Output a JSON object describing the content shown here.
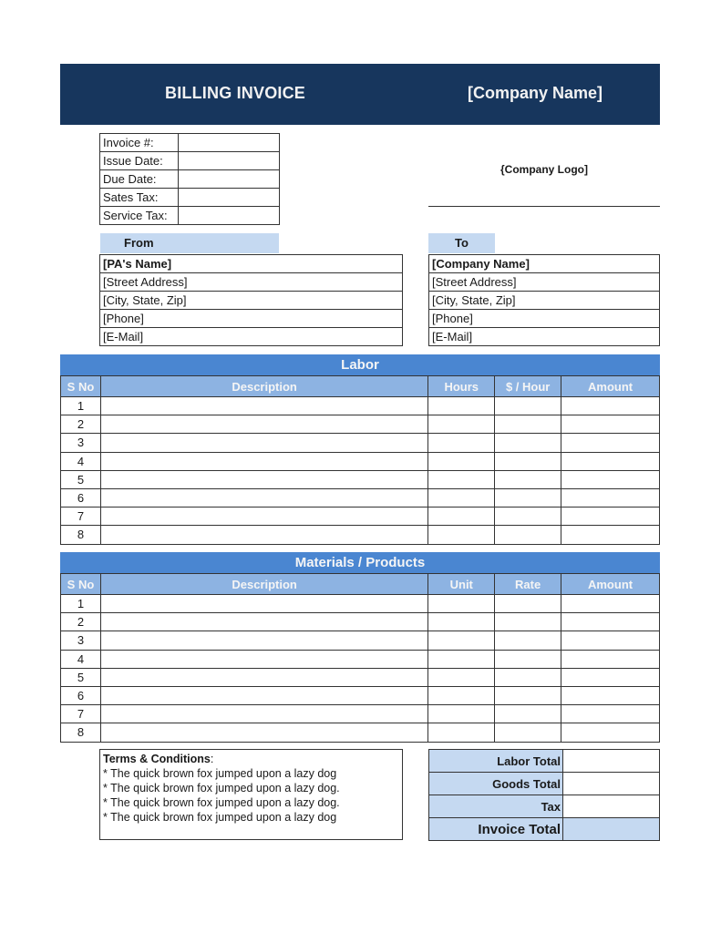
{
  "header": {
    "title": "BILLING INVOICE",
    "company_name": "[Company Name]"
  },
  "meta_fields": [
    {
      "label": "Invoice #:",
      "value": ""
    },
    {
      "label": "Issue Date:",
      "value": ""
    },
    {
      "label": "Due Date:",
      "value": ""
    },
    {
      "label": "Sates Tax:",
      "value": ""
    },
    {
      "label": "Service Tax:",
      "value": ""
    }
  ],
  "logo_placeholder": "{Company Logo]",
  "from": {
    "heading": "From",
    "lines": [
      "[PA's Name]",
      "[Street Address]",
      "[City, State, Zip]",
      "[Phone]",
      "[E-Mail]"
    ]
  },
  "to": {
    "heading": "To",
    "lines": [
      "[Company Name]",
      "[Street Address]",
      "[City, State, Zip]",
      "[Phone]",
      "[E-Mail]"
    ]
  },
  "labor": {
    "title": "Labor",
    "columns": [
      "S No",
      "Description",
      "Hours",
      "$ / Hour",
      "Amount"
    ],
    "rows": [
      [
        "1",
        "",
        "",
        "",
        ""
      ],
      [
        "2",
        "",
        "",
        "",
        ""
      ],
      [
        "3",
        "",
        "",
        "",
        ""
      ],
      [
        "4",
        "",
        "",
        "",
        ""
      ],
      [
        "5",
        "",
        "",
        "",
        ""
      ],
      [
        "6",
        "",
        "",
        "",
        ""
      ],
      [
        "7",
        "",
        "",
        "",
        ""
      ],
      [
        "8",
        "",
        "",
        "",
        ""
      ]
    ]
  },
  "materials": {
    "title": "Materials / Products",
    "columns": [
      "S No",
      "Description",
      "Unit",
      "Rate",
      "Amount"
    ],
    "rows": [
      [
        "1",
        "",
        "",
        "",
        ""
      ],
      [
        "2",
        "",
        "",
        "",
        ""
      ],
      [
        "3",
        "",
        "",
        "",
        ""
      ],
      [
        "4",
        "",
        "",
        "",
        ""
      ],
      [
        "5",
        "",
        "",
        "",
        ""
      ],
      [
        "6",
        "",
        "",
        "",
        ""
      ],
      [
        "7",
        "",
        "",
        "",
        ""
      ],
      [
        "8",
        "",
        "",
        "",
        ""
      ]
    ]
  },
  "terms": {
    "title": "Terms & Conditions",
    "colon": ":",
    "lines": [
      "* The quick brown fox jumped upon a lazy dog",
      "* The quick brown fox jumped upon a lazy dog.",
      "* The quick brown fox jumped upon a lazy dog.",
      "* The quick brown fox jumped upon a lazy dog"
    ]
  },
  "totals": [
    {
      "label": "Labor Total",
      "value": ""
    },
    {
      "label": "Goods Total",
      "value": ""
    },
    {
      "label": "Tax",
      "value": ""
    },
    {
      "label": "Invoice Total",
      "value": ""
    }
  ],
  "colors": {
    "banner": "#17365d",
    "section_header": "#4a86d1",
    "column_header": "#8db3e2",
    "light_accent": "#c5d9f1"
  }
}
